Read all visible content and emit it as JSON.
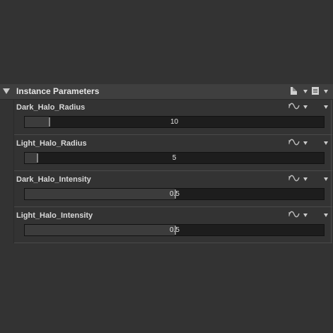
{
  "panel": {
    "title": "Instance Parameters"
  },
  "icons": {
    "collapse": "triangle-down-icon",
    "page": "page-icon",
    "doc": "document-list-icon",
    "wave": "wave-icon"
  },
  "parameters": [
    {
      "label": "Dark_Halo_Radius",
      "value": "10",
      "fraction": 0.08
    },
    {
      "label": "Light_Halo_Radius",
      "value": "5",
      "fraction": 0.04
    },
    {
      "label": "Dark_Halo_Intensity",
      "value": "0.5",
      "fraction": 0.5
    },
    {
      "label": "Light_Halo_Intensity",
      "value": "0.5",
      "fraction": 0.5
    }
  ],
  "colors": {
    "background": "#333333",
    "header": "#3f3f3f",
    "slider_track": "#1d1d1d",
    "slider_fill": "#3c3c3c",
    "text": "#e6e6e6"
  }
}
